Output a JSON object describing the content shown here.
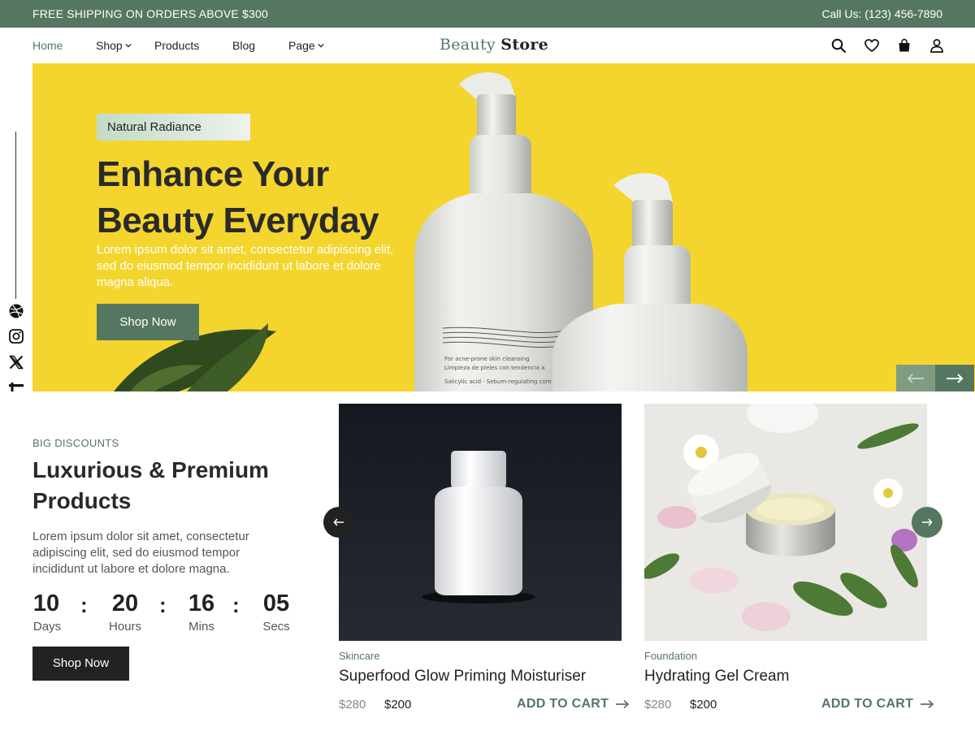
{
  "topbar": {
    "promo": "FREE SHIPPING ON ORDERS ABOVE $300",
    "phone": "Call Us: (123) 456-7890"
  },
  "nav": {
    "items": [
      {
        "label": "Home",
        "active": true
      },
      {
        "label": "Shop",
        "dropdown": true
      },
      {
        "label": "Products"
      },
      {
        "label": "Blog"
      },
      {
        "label": "Page",
        "dropdown": true
      }
    ],
    "logo_part1": "Beauty",
    "logo_part2": "Store",
    "icons": [
      "search-icon",
      "heart-icon",
      "shopping-bag-icon",
      "user-icon"
    ]
  },
  "social": {
    "icons": [
      "dribbble-icon",
      "instagram-icon",
      "x-icon",
      "facebook-icon"
    ]
  },
  "hero": {
    "badge": "Natural Radiance",
    "title": "Enhance Your Beauty Everyday",
    "description": "Lorem ipsum dolor sit amet, consectetur adipiscing elit, sed do eiusmod tempor incididunt ut labore et dolore magna aliqua.",
    "button": "Shop Now",
    "background_color": "#f4d52e"
  },
  "discount": {
    "eyebrow": "BIG DISCOUNTS",
    "title": "Luxurious & Premium Products",
    "description": "Lorem ipsum dolor sit amet, consectetur adipiscing elit, sed do eiusmod tempor incididunt ut labore et dolore magna.",
    "countdown": [
      {
        "value": "10",
        "label": "Days"
      },
      {
        "value": "20",
        "label": "Hours"
      },
      {
        "value": "16",
        "label": "Mins"
      },
      {
        "value": "05",
        "label": "Secs"
      }
    ],
    "separator": ":",
    "button": "Shop Now"
  },
  "products": [
    {
      "category": "Skincare",
      "name": "Superfood Glow Priming Moisturiser",
      "old_price": "$280",
      "price": "$200",
      "cart": "ADD TO CART"
    },
    {
      "category": "Foundation",
      "name": "Hydrating Gel Cream",
      "old_price": "$280",
      "price": "$200",
      "cart": "ADD TO CART"
    }
  ],
  "colors": {
    "accent": "#557761",
    "dark": "#222222",
    "hero_yellow": "#f4d52e"
  }
}
